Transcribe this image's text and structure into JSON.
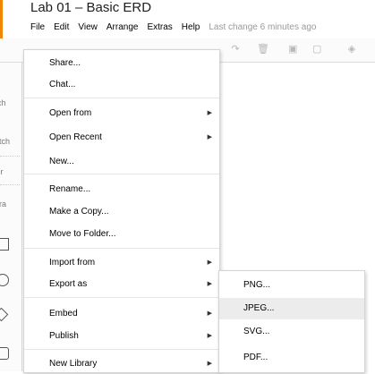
{
  "app": {
    "title": "Lab 01 – Basic ERD",
    "accent_color": "#f08705"
  },
  "menubar": {
    "items": [
      "File",
      "Edit",
      "View",
      "Arrange",
      "Extras",
      "Help"
    ],
    "status": "Last change 6 minutes ago"
  },
  "toolbar": {
    "icons": [
      "redo-icon",
      "delete-icon",
      "to-front-icon",
      "to-back-icon",
      "fill-color-icon"
    ]
  },
  "left_panel": {
    "labels": [
      "rch",
      "atch",
      "Dr",
      "era"
    ]
  },
  "file_menu": {
    "items": [
      {
        "label": "Share...",
        "submenu": false
      },
      {
        "label": "Chat...",
        "submenu": false
      },
      {
        "label": "Open from",
        "submenu": true
      },
      {
        "label": "Open Recent",
        "submenu": true
      },
      {
        "label": "New...",
        "submenu": false
      },
      {
        "label": "Rename...",
        "submenu": false
      },
      {
        "label": "Make a Copy...",
        "submenu": false
      },
      {
        "label": "Move to Folder...",
        "submenu": false
      },
      {
        "label": "Import from",
        "submenu": true
      },
      {
        "label": "Export as",
        "submenu": true
      },
      {
        "label": "Embed",
        "submenu": true
      },
      {
        "label": "Publish",
        "submenu": true
      },
      {
        "label": "New Library",
        "submenu": true
      }
    ],
    "submenu_arrow": "▶"
  },
  "export_submenu": {
    "items": [
      "PNG...",
      "JPEG...",
      "SVG...",
      "PDF..."
    ],
    "highlighted": "JPEG..."
  }
}
